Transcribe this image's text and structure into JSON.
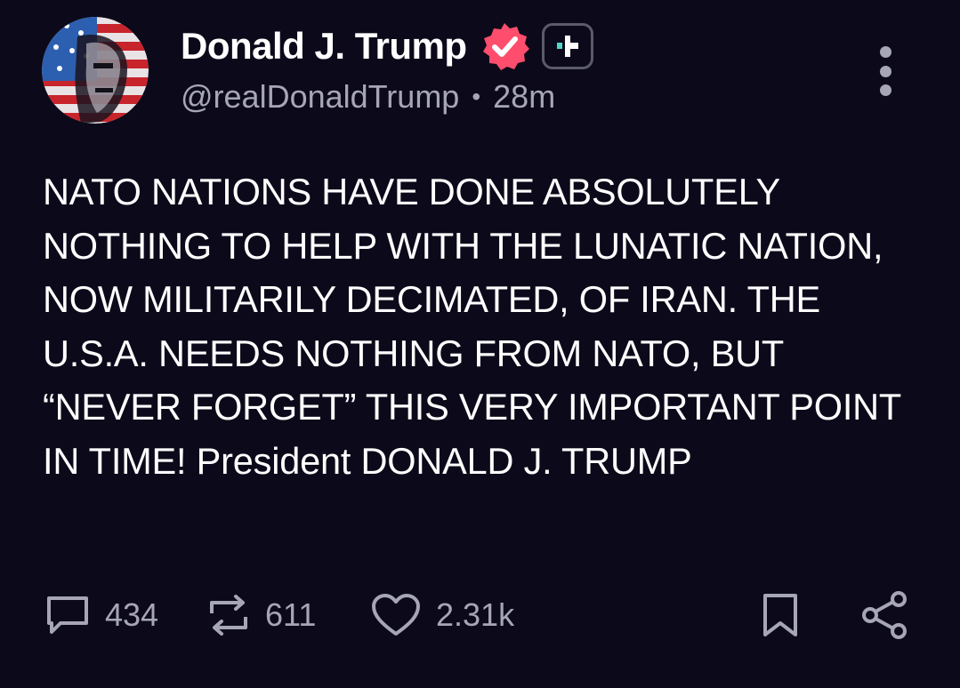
{
  "author": {
    "display_name": "Donald J. Trump",
    "handle": "@realDonaldTrump",
    "separator": "•",
    "timestamp": "28m",
    "verified_icon": "verified-badge-icon",
    "follow_icon": "follow-plus-icon"
  },
  "post": {
    "text": "NATO NATIONS HAVE DONE ABSOLUTELY NOTHING TO HELP WITH THE LUNATIC NATION, NOW MILITARILY DECIMATED, OF IRAN. THE U.S.A. NEEDS NOTHING FROM NATO, BUT “NEVER FORGET” THIS VERY IMPORTANT POINT IN TIME! President DONALD J. TRUMP"
  },
  "actions": {
    "replies": "434",
    "reposts": "611",
    "likes": "2.31k"
  },
  "colors": {
    "background": "#0c0a1a",
    "text_primary": "#ffffff",
    "text_secondary": "#a6a6b6",
    "verified_badge": "#ff4d6d"
  }
}
